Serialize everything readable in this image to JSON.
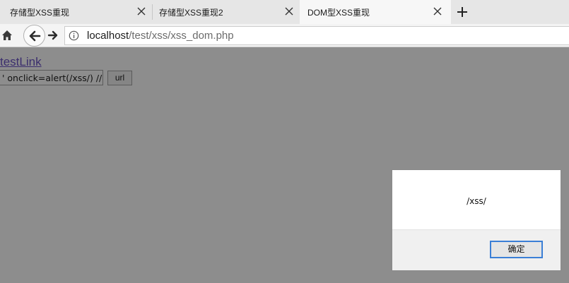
{
  "tabs": [
    {
      "label": "存储型XSS重现"
    },
    {
      "label": "存储型XSS重现2"
    },
    {
      "label": "DOM型XSS重现"
    }
  ],
  "address": {
    "host": "localhost",
    "path": "/test/xss/xss_dom.php"
  },
  "page": {
    "link_text": "testLink",
    "input_value": "' onclick=alert(/xss/) //",
    "button_label": "url"
  },
  "dialog": {
    "message": "/xss/",
    "ok_label": "确定"
  },
  "icons": [
    "home-icon",
    "back-icon",
    "forward-icon",
    "info-icon",
    "close-icon",
    "plus-icon"
  ]
}
